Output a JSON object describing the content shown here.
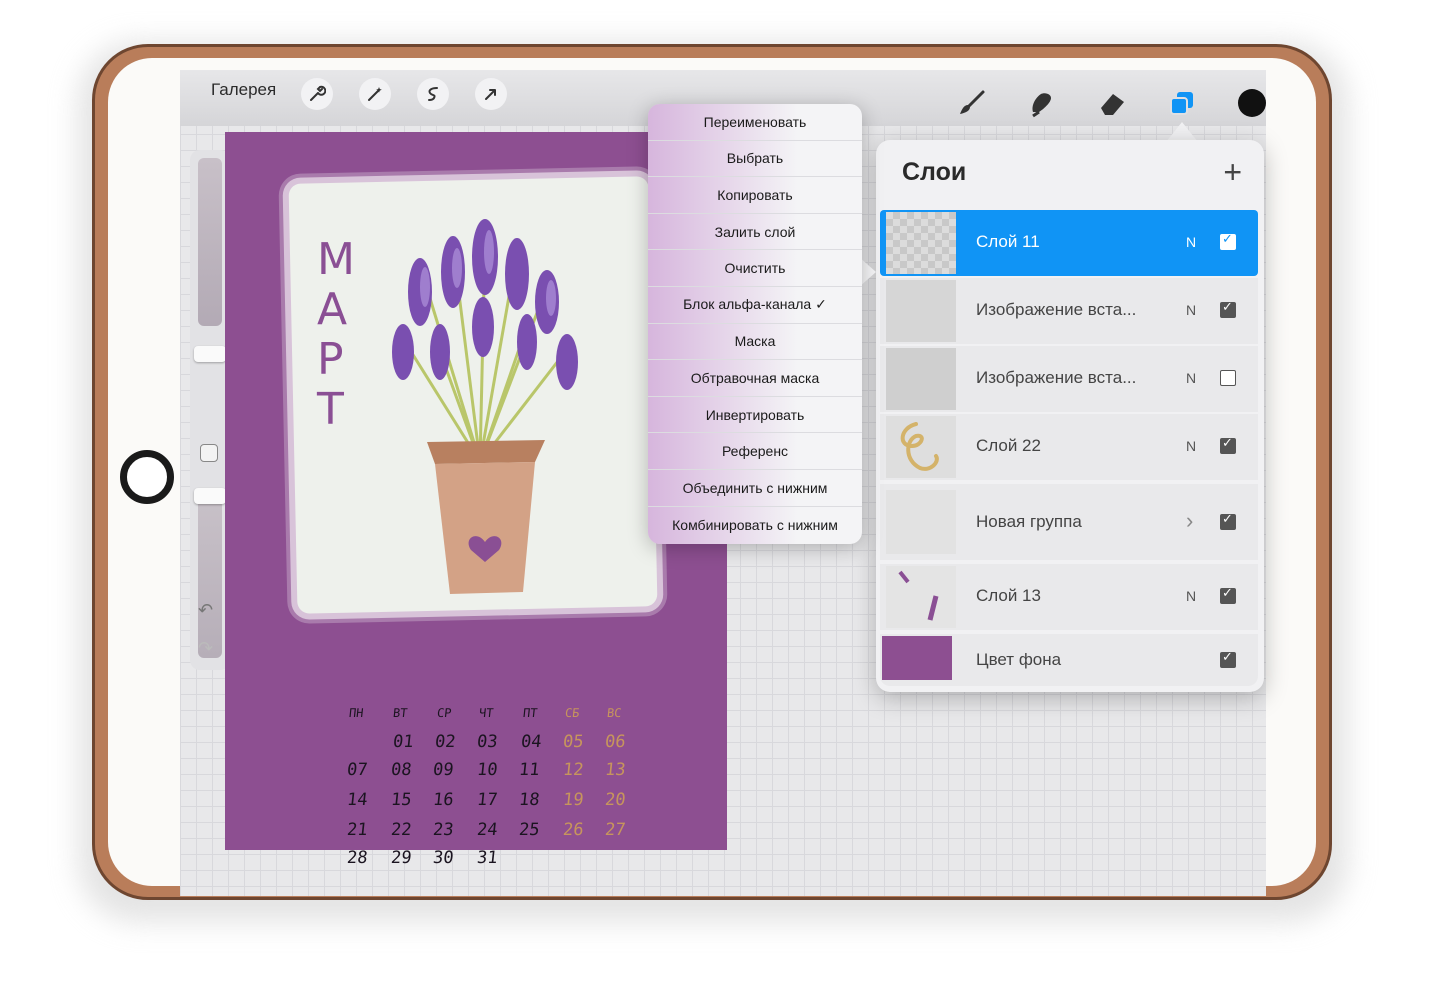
{
  "toolbar": {
    "gallery": "Галерея",
    "tools_left": [
      "wrench-icon",
      "magic-wand-icon",
      "selection-icon",
      "transform-arrow-icon"
    ],
    "tools_right": [
      "brush-icon",
      "smudge-icon",
      "eraser-icon",
      "layers-icon",
      "color-swatch"
    ],
    "current_color": "#111111"
  },
  "artwork": {
    "month_letters": [
      "М",
      "А",
      "Р",
      "Т"
    ],
    "weekdays": [
      "ПН",
      "ВТ",
      "СР",
      "ЧТ",
      "ПТ",
      "СБ",
      "ВС"
    ],
    "weeks": [
      [
        "",
        "01",
        "02",
        "03",
        "04",
        "05",
        "06"
      ],
      [
        "07",
        "08",
        "09",
        "10",
        "11",
        "12",
        "13"
      ],
      [
        "14",
        "15",
        "16",
        "17",
        "18",
        "19",
        "20"
      ],
      [
        "21",
        "22",
        "23",
        "24",
        "25",
        "26",
        "27"
      ],
      [
        "28",
        "29",
        "30",
        "31",
        "",
        "",
        ""
      ]
    ],
    "background_color": "#8d4f91"
  },
  "context_menu": {
    "items": [
      "Переименовать",
      "Выбрать",
      "Копировать",
      "Залить слой",
      "Очистить",
      "Блок альфа-канала ✓",
      "Маска",
      "Обтравочная маска",
      "Инвертировать",
      "Референс",
      "Объединить с нижним",
      "Комбинировать с нижним"
    ]
  },
  "layers": {
    "title": "Слои",
    "add_symbol": "+",
    "items": [
      {
        "name": "Слой 11",
        "mode": "N",
        "visible": true,
        "active": true
      },
      {
        "name": "Изображение вста...",
        "mode": "N",
        "visible": true,
        "active": false
      },
      {
        "name": "Изображение вста...",
        "mode": "N",
        "visible": false,
        "active": false
      },
      {
        "name": "Слой 22",
        "mode": "N",
        "visible": true,
        "active": false
      },
      {
        "name": "Новая группа",
        "mode": "",
        "visible": true,
        "active": false,
        "group": true
      },
      {
        "name": "Слой 13",
        "mode": "N",
        "visible": true,
        "active": false
      },
      {
        "name": "Цвет фона",
        "mode": "",
        "visible": true,
        "active": false
      }
    ]
  },
  "accent_color": "#1094f5"
}
